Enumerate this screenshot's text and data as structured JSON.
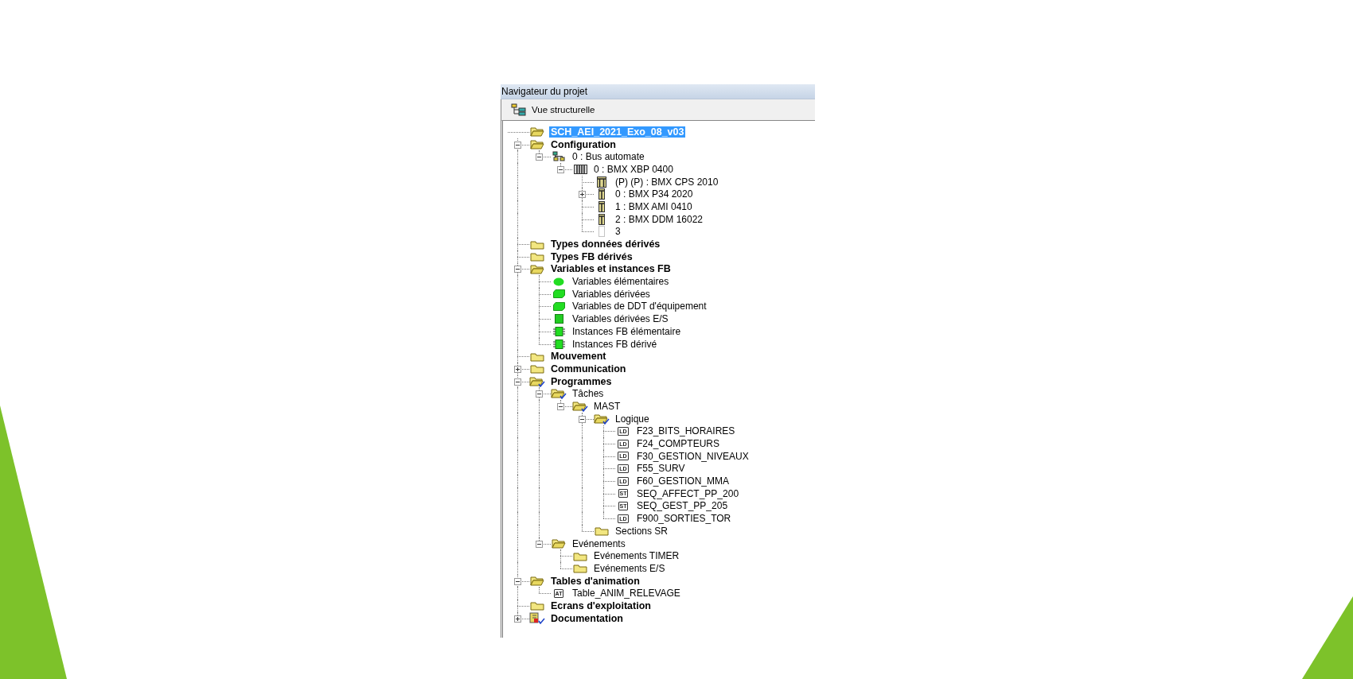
{
  "window": {
    "title": "Navigateur du projet"
  },
  "view": {
    "label": "Vue structurelle"
  },
  "tree": [
    {
      "label": "SCH_AEI_2021_Exo_08_v03",
      "kind": "folder-open",
      "selected": true,
      "children": [
        {
          "label": "Configuration",
          "kind": "folder-open",
          "expanded": true,
          "selected": false,
          "children": [
            {
              "label": "0 : Bus automate",
              "kind": "network",
              "expanded": true,
              "selected": false,
              "children": [
                {
                  "label": "0 : BMX XBP 0400",
                  "kind": "rack",
                  "expanded": true,
                  "selected": false,
                  "children": [
                    {
                      "label": "(P) (P) : BMX CPS 2010",
                      "kind": "module-double",
                      "selected": false
                    },
                    {
                      "label": "0 : BMX P34 2020",
                      "kind": "module",
                      "expanded": false,
                      "selected": false
                    },
                    {
                      "label": "1 : BMX AMI 0410",
                      "kind": "module",
                      "selected": false
                    },
                    {
                      "label": "2 : BMX DDM 16022",
                      "kind": "module",
                      "selected": false
                    },
                    {
                      "label": "3",
                      "kind": "slot-empty",
                      "selected": false
                    }
                  ]
                }
              ]
            }
          ]
        },
        {
          "label": "Types données dérivés",
          "kind": "folder",
          "selected": false
        },
        {
          "label": "Types FB dérivés",
          "kind": "folder",
          "selected": false
        },
        {
          "label": "Variables et instances FB",
          "kind": "folder-open",
          "expanded": true,
          "selected": false,
          "children": [
            {
              "label": "Variables élémentaires",
              "kind": "var-round",
              "selected": false
            },
            {
              "label": "Variables dérivées",
              "kind": "var-block",
              "selected": false
            },
            {
              "label": "Variables de DDT d'équipement",
              "kind": "var-block",
              "selected": false
            },
            {
              "label": "Variables dérivées E/S",
              "kind": "var-square",
              "selected": false
            },
            {
              "label": "Instances FB élémentaire",
              "kind": "fb-chip",
              "selected": false
            },
            {
              "label": "Instances FB dérivé",
              "kind": "fb-chip",
              "selected": false
            }
          ]
        },
        {
          "label": "Mouvement",
          "kind": "folder",
          "selected": false
        },
        {
          "label": "Communication",
          "kind": "folder",
          "expanded": false,
          "selected": false
        },
        {
          "label": "Programmes",
          "kind": "folder-open-tick",
          "expanded": true,
          "selected": false,
          "children": [
            {
              "label": "Tâches",
              "kind": "folder-open-tick",
              "expanded": true,
              "selected": false,
              "children": [
                {
                  "label": "MAST",
                  "kind": "folder-open-tick",
                  "expanded": true,
                  "selected": false,
                  "children": [
                    {
                      "label": "Logique",
                      "kind": "folder-open-tick",
                      "expanded": true,
                      "selected": false,
                      "children": [
                        {
                          "label": "F23_BITS_HORAIRES",
                          "kind": "badge",
                          "badge": "LD",
                          "selected": false
                        },
                        {
                          "label": "F24_COMPTEURS",
                          "kind": "badge",
                          "badge": "LD",
                          "selected": false
                        },
                        {
                          "label": "F30_GESTION_NIVEAUX",
                          "kind": "badge",
                          "badge": "LD",
                          "selected": false
                        },
                        {
                          "label": "F55_SURV",
                          "kind": "badge",
                          "badge": "LD",
                          "selected": false
                        },
                        {
                          "label": "F60_GESTION_MMA",
                          "kind": "badge",
                          "badge": "LD",
                          "selected": false
                        },
                        {
                          "label": "SEQ_AFFECT_PP_200",
                          "kind": "badge",
                          "badge": "ST",
                          "selected": false
                        },
                        {
                          "label": "SEQ_GEST_PP_205",
                          "kind": "badge",
                          "badge": "ST",
                          "selected": false
                        },
                        {
                          "label": "F900_SORTIES_TOR",
                          "kind": "badge",
                          "badge": "LD",
                          "selected": false
                        }
                      ]
                    },
                    {
                      "label": "Sections SR",
                      "kind": "folder",
                      "selected": false
                    }
                  ]
                }
              ]
            },
            {
              "label": "Evénements",
              "kind": "folder-open",
              "expanded": true,
              "selected": false,
              "children": [
                {
                  "label": "Evénements TIMER",
                  "kind": "folder",
                  "selected": false
                },
                {
                  "label": "Evénements E/S",
                  "kind": "folder",
                  "selected": false
                }
              ]
            }
          ]
        },
        {
          "label": "Tables d'animation",
          "kind": "folder-open",
          "expanded": true,
          "selected": false,
          "children": [
            {
              "label": "Table_ANIM_RELEVAGE",
              "kind": "badge",
              "badge": "AT",
              "selected": false
            }
          ]
        },
        {
          "label": "Ecrans d'exploitation",
          "kind": "folder",
          "selected": false
        },
        {
          "label": "Documentation",
          "kind": "doc",
          "expanded": false,
          "selected": false
        }
      ]
    }
  ]
}
